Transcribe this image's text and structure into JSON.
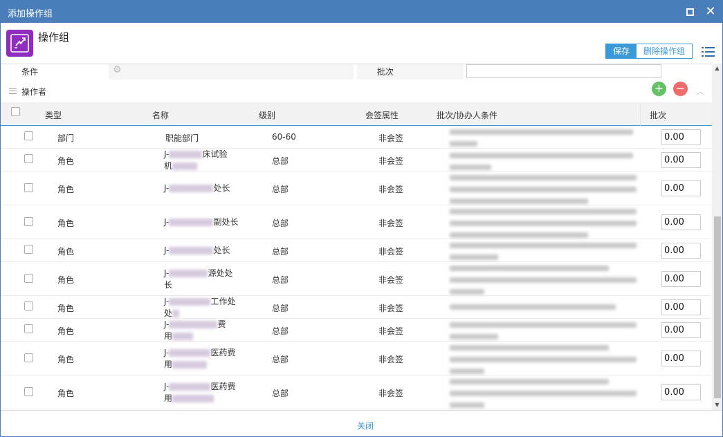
{
  "window": {
    "title": "添加操作组"
  },
  "header": {
    "group_title": "操作组",
    "save_label": "保存",
    "delete_label": "删除操作组"
  },
  "conditions": {
    "condition_label": "条件",
    "batch_label": "批次",
    "batch_value": ""
  },
  "section": {
    "title": "操作者"
  },
  "table": {
    "columns": [
      "类型",
      "名称",
      "级别",
      "会签属性",
      "批次/协办人条件",
      "批次"
    ],
    "rows": [
      {
        "type": "部门",
        "name": "职能部门",
        "level": "60-60",
        "attr": "非会签",
        "batch": "0.00"
      },
      {
        "type": "角色",
        "name_a": "J-",
        "name_b": "床试验",
        "name_c": "机",
        "level": "总部",
        "attr": "非会签",
        "batch": "0.00"
      },
      {
        "type": "角色",
        "name_a": "J-",
        "name_b": "处长",
        "level": "总部",
        "attr": "非会签",
        "batch": "0.00"
      },
      {
        "type": "角色",
        "name_a": "J-",
        "name_b": "副处长",
        "level": "总部",
        "attr": "非会签",
        "batch": "0.00"
      },
      {
        "type": "角色",
        "name_a": "J-",
        "name_b": "处长",
        "level": "总部",
        "attr": "非会签",
        "batch": "0.00"
      },
      {
        "type": "角色",
        "name_a": "J-",
        "name_b": "源处处",
        "name_c": "长",
        "level": "总部",
        "attr": "非会签",
        "batch": "0.00"
      },
      {
        "type": "角色",
        "name_a": "J-",
        "name_b": "工作处",
        "name_c": "处",
        "level": "总部",
        "attr": "非会签",
        "batch": "0.00"
      },
      {
        "type": "角色",
        "name_a": "J-",
        "name_b": "费",
        "name_c": "用",
        "level": "总部",
        "attr": "非会签",
        "batch": "0.00"
      },
      {
        "type": "角色",
        "name_a": "J-",
        "name_b": "医药费",
        "name_c": "用",
        "level": "总部",
        "attr": "非会签",
        "batch": "0.00"
      },
      {
        "type": "角色",
        "name_a": "J-",
        "name_b": "医药费",
        "name_c": "用",
        "level": "总部",
        "attr": "非会签",
        "batch": "0.00"
      }
    ]
  },
  "footer": {
    "close_label": "关闭"
  },
  "colors": {
    "title_bar": "#4a7ebb",
    "accent": "#3a9ad9",
    "app_icon": "#8e2dbe",
    "add": "#63c065",
    "remove": "#ee6c6c"
  },
  "icons": [
    "app-icon",
    "maximize-icon",
    "close-icon",
    "list-menu-icon",
    "gear-icon",
    "drag-handle-icon",
    "add-icon",
    "remove-icon",
    "collapse-icon"
  ]
}
